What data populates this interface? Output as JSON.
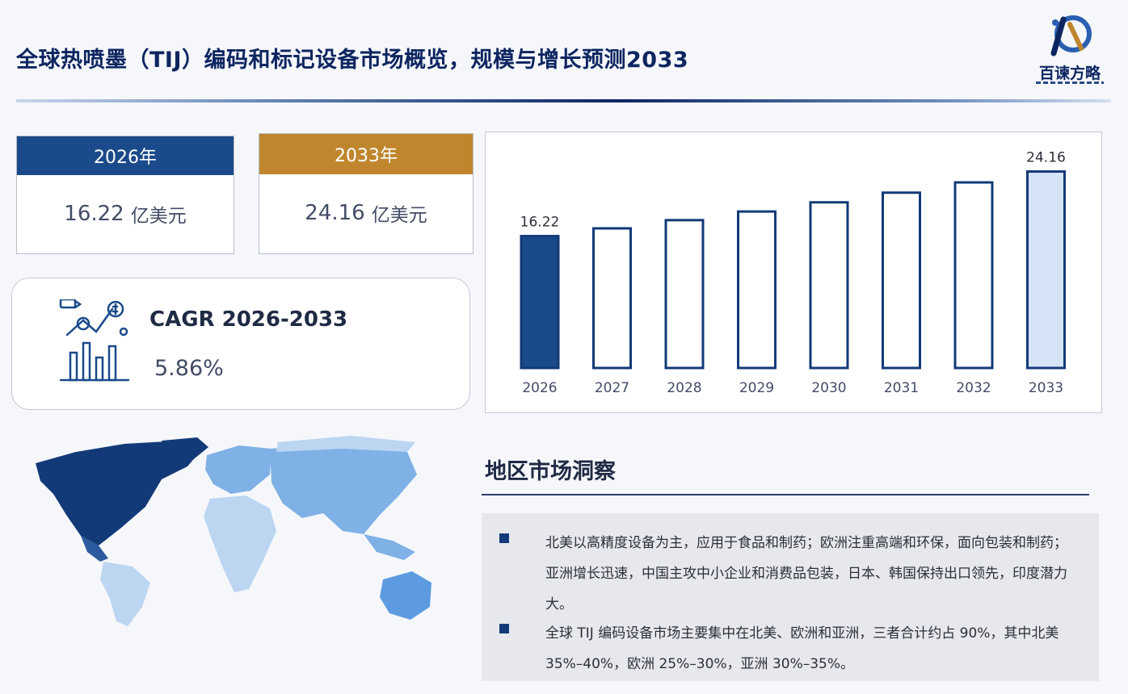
{
  "title": "全球热喷墨（TIJ）编码和标记设备市场概览，规模与增长预测2033",
  "logo": {
    "text": "百谏方略"
  },
  "kpis": [
    {
      "year": "2026年",
      "value": "16.22",
      "unit": "亿美元",
      "color": "#1a4a8a"
    },
    {
      "year": "2033年",
      "value": "24.16",
      "unit": "亿美元",
      "color": "#c0862e"
    }
  ],
  "cagr": {
    "label": "CAGR 2026-2033",
    "value": "5.86%"
  },
  "chart_data": {
    "type": "bar",
    "categories": [
      "2026",
      "2027",
      "2028",
      "2029",
      "2030",
      "2031",
      "2032",
      "2033"
    ],
    "values": [
      16.22,
      17.17,
      18.18,
      19.24,
      20.37,
      21.56,
      22.82,
      24.16
    ],
    "data_labels": [
      {
        "category": "2026",
        "text": "16.22"
      },
      {
        "category": "2033",
        "text": "24.16"
      }
    ],
    "title": "",
    "xlabel": "",
    "ylabel": "",
    "ylim": [
      0,
      26
    ],
    "grid": false,
    "colors": {
      "first": "#1a4a8a",
      "last_fill": "#d6e4f7",
      "default_fill": "#ffffff",
      "outline": "#123a78"
    }
  },
  "region": {
    "heading": "地区市场洞察",
    "bullets": [
      "北美以高精度设备为主，应用于食品和制药；欧洲注重高端和环保，面向包装和制药；亚洲增长迅速，中国主攻中小企业和消费品包装，日本、韩国保持出口领先，印度潜力大。",
      "全球 TIJ 编码设备市场主要集中在北美、欧洲和亚洲，三者合计约占 90%，其中北美 35%–40%，欧洲 25%–30%，亚洲 30%–35%。"
    ]
  },
  "colors": {
    "navy": "#0d2560",
    "bar_outline": "#123a78",
    "map_dark": "#123a78",
    "map_mid": "#7fb1e6",
    "map_light": "#bcd6f2"
  }
}
